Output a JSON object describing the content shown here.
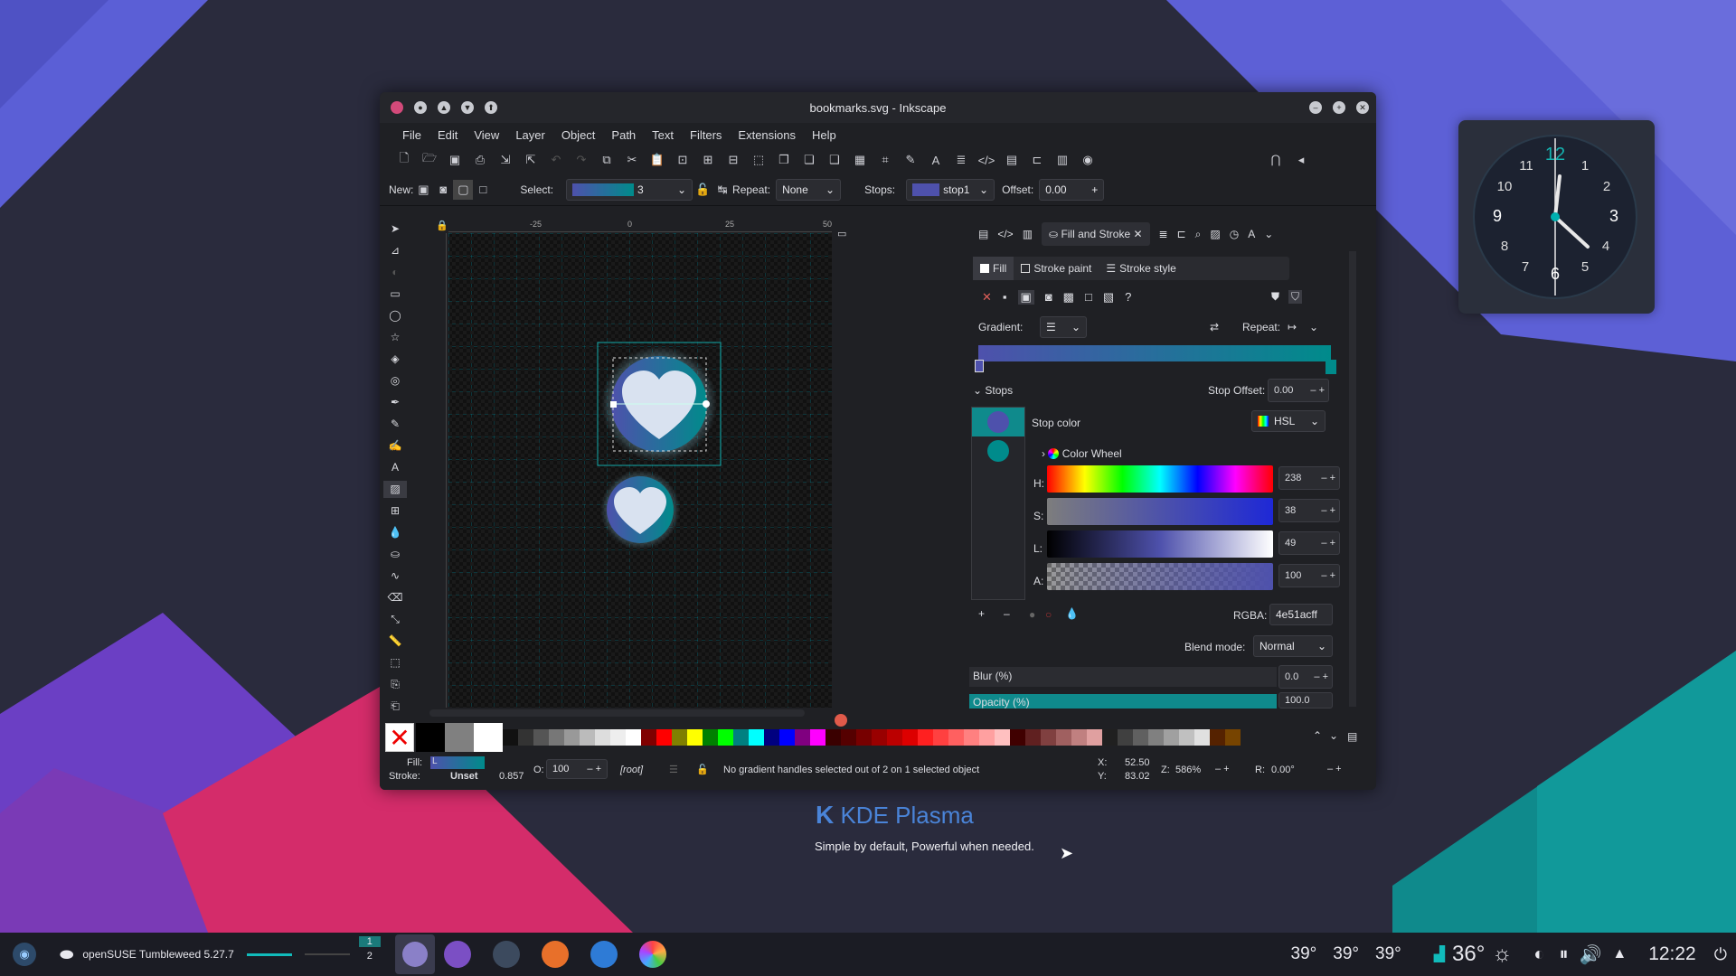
{
  "window": {
    "title": "bookmarks.svg - Inkscape"
  },
  "menu": [
    "File",
    "Edit",
    "View",
    "Layer",
    "Object",
    "Path",
    "Text",
    "Filters",
    "Extensions",
    "Help"
  ],
  "ctrl": {
    "new_label": "New:",
    "select_label": "Select:",
    "select_value": "3",
    "repeat_label": "Repeat:",
    "repeat_value": "None",
    "stops_label": "Stops:",
    "stops_value": "stop1",
    "offset_label": "Offset:",
    "offset_value": "0.00"
  },
  "panel": {
    "tab_title": "Fill and Stroke",
    "subtabs": [
      "Fill",
      "Stroke paint",
      "Stroke style"
    ],
    "gradient_label": "Gradient:",
    "repeat_label": "Repeat:",
    "stops_label": "Stops",
    "stop_offset_label": "Stop Offset:",
    "stop_offset_value": "0.00",
    "stop_color_label": "Stop color",
    "mode": "HSL",
    "color_wheel_label": "Color Wheel",
    "h_label": "H:",
    "h_value": "238",
    "s_label": "S:",
    "s_value": "38",
    "l_label": "L:",
    "l_value": "49",
    "a_label": "A:",
    "a_value": "100",
    "rgba_label": "RGBA:",
    "rgba_value": "4e51acff",
    "blend_label": "Blend mode:",
    "blend_value": "Normal",
    "blur_label": "Blur (%)",
    "blur_value": "0.0",
    "opacity_label": "Opacity (%)",
    "opacity_value": "100.0"
  },
  "ruler": {
    "t1": "-25",
    "t2": "0",
    "t3": "25",
    "t4": "50"
  },
  "status": {
    "fill_label": "Fill:",
    "fill_value": "L",
    "stroke_label": "Stroke:",
    "stroke_value": "Unset",
    "stroke_width": "0.857",
    "o_label": "O:",
    "o_value": "100",
    "layer": "[root]",
    "message": "No gradient handles selected out of 2 on 1 selected object",
    "x_label": "X:",
    "x_value": "52.50",
    "y_label": "Y:",
    "y_value": "83.02",
    "z_label": "Z:",
    "z_value": "586%",
    "r_label": "R:",
    "r_value": "0.00°"
  },
  "desktop": {
    "kde_title": "KDE Plasma",
    "kde_tagline": "Simple by default, Powerful when needed."
  },
  "clock": {
    "n12": "12",
    "n1": "1",
    "n2": "2",
    "n3": "3",
    "n4": "4",
    "n5": "5",
    "n6": "6",
    "n7": "7",
    "n8": "8",
    "n9": "9",
    "n10": "10",
    "n11": "11"
  },
  "taskbar": {
    "os_label": "openSUSE Tumbleweed 5.27.7",
    "pager1": "1",
    "pager2": "2",
    "temp1": "39°",
    "temp2": "39°",
    "temp3": "39°",
    "weather": "36°",
    "time": "12:22"
  },
  "colors": {
    "accent": "#00a7a7",
    "stop1": "#4e51ac",
    "stop2": "#008b8b"
  }
}
